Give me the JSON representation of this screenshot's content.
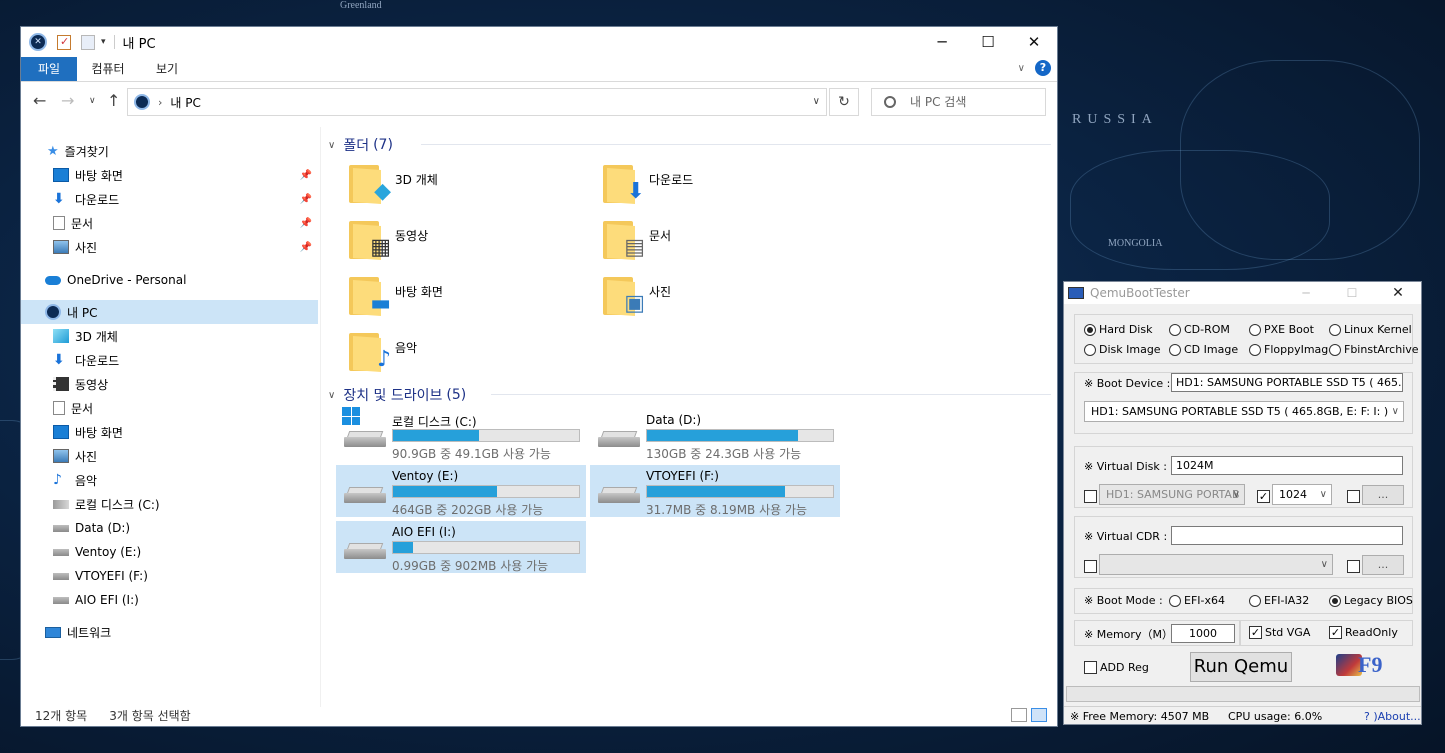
{
  "wallpaper": {
    "labels": [
      "RUSSIA",
      "MONGOLIA",
      "Greenland"
    ]
  },
  "explorer": {
    "title": "내 PC",
    "ribbon_tabs": [
      "파일",
      "컴퓨터",
      "보기"
    ],
    "help_glyph": "?",
    "address": {
      "location": "내 PC"
    },
    "search": {
      "placeholder": "내 PC 검색"
    },
    "nav": {
      "quick_access": "즐겨찾기",
      "pinned": [
        "바탕 화면",
        "다운로드",
        "문서",
        "사진"
      ],
      "onedrive": "OneDrive - Personal",
      "this_pc": "내 PC",
      "pc_items": [
        "3D 개체",
        "다운로드",
        "동영상",
        "문서",
        "바탕 화면",
        "사진",
        "음악",
        "로컬 디스크 (C:)",
        "Data (D:)",
        "Ventoy (E:)",
        "VTOYEFI (F:)",
        "AIO EFI (I:)"
      ],
      "network": "네트워크"
    },
    "folders_group": {
      "title": "폴더",
      "count": "(7)"
    },
    "folders": [
      {
        "name": "3D 개체",
        "icon": "3d-objects-icon"
      },
      {
        "name": "다운로드",
        "icon": "download-arrow-icon"
      },
      {
        "name": "동영상",
        "icon": "film-strip-icon"
      },
      {
        "name": "문서",
        "icon": "document-icon"
      },
      {
        "name": "바탕 화면",
        "icon": "desktop-icon"
      },
      {
        "name": "사진",
        "icon": "picture-icon"
      },
      {
        "name": "음악",
        "icon": "music-note-icon"
      }
    ],
    "drives_group": {
      "title": "장치 및 드라이브",
      "count": "(5)"
    },
    "drives": [
      {
        "name": "로컬 디스크 (C:)",
        "free": "90.9GB 중 49.1GB 사용 가능",
        "used_fraction": 0.46,
        "selected": false
      },
      {
        "name": "Data (D:)",
        "free": "130GB 중 24.3GB 사용 가능",
        "used_fraction": 0.81,
        "selected": false
      },
      {
        "name": "Ventoy (E:)",
        "free": "464GB 중 202GB 사용 가능",
        "used_fraction": 0.56,
        "selected": true
      },
      {
        "name": "VTOYEFI (F:)",
        "free": "31.7MB 중 8.19MB 사용 가능",
        "used_fraction": 0.74,
        "selected": true
      },
      {
        "name": "AIO EFI (I:)",
        "free": "0.99GB 중 902MB 사용 가능",
        "used_fraction": 0.11,
        "selected": true
      }
    ],
    "status": {
      "items": "12개 항목",
      "selected": "3개 항목 선택함"
    }
  },
  "qemu": {
    "title": "QemuBootTester",
    "boot_sources": [
      {
        "label": "Hard Disk",
        "checked": true
      },
      {
        "label": "CD-ROM",
        "checked": false
      },
      {
        "label": "PXE Boot",
        "checked": false
      },
      {
        "label": "Linux Kernel",
        "checked": false
      },
      {
        "label": "Disk Image",
        "checked": false
      },
      {
        "label": "CD Image",
        "checked": false
      },
      {
        "label": "FloppyImage",
        "checked": false
      },
      {
        "label": "FbinstArchive",
        "checked": false
      }
    ],
    "boot_device": {
      "label": "※ Boot Device :",
      "value": "HD1: SAMSUNG PORTABLE SSD T5 ( 465.8GB,",
      "select": "HD1: SAMSUNG PORTABLE SSD T5 ( 465.8GB,  E: F: I: )"
    },
    "virtual_disk": {
      "label": "※ Virtual Disk :",
      "value": "1024M",
      "disk_select": "HD1: SAMSUNG PORTAB",
      "size_select": "1024",
      "browse": "..."
    },
    "virtual_cdr": {
      "label": "※ Virtual CDR :",
      "value": "",
      "browse": "..."
    },
    "boot_mode": {
      "label": "※ Boot Mode :",
      "options": [
        {
          "label": "EFI-x64",
          "checked": false
        },
        {
          "label": "EFI-IA32",
          "checked": false
        },
        {
          "label": "Legacy BIOS",
          "checked": true
        }
      ]
    },
    "memory": {
      "label": "※ Memory（M）:",
      "value": "1000"
    },
    "std_vga": {
      "label": "Std VGA",
      "checked": true
    },
    "read_only": {
      "label": "ReadOnly",
      "checked": true
    },
    "add_reg": {
      "label": "ADD Reg",
      "checked": false
    },
    "run_button": "Run Qemu",
    "logo_text": "F9",
    "status": {
      "free_memory": "※ Free Memory: 4507 MB",
      "cpu": "CPU usage: 6.0%",
      "about": "? )About..."
    }
  }
}
